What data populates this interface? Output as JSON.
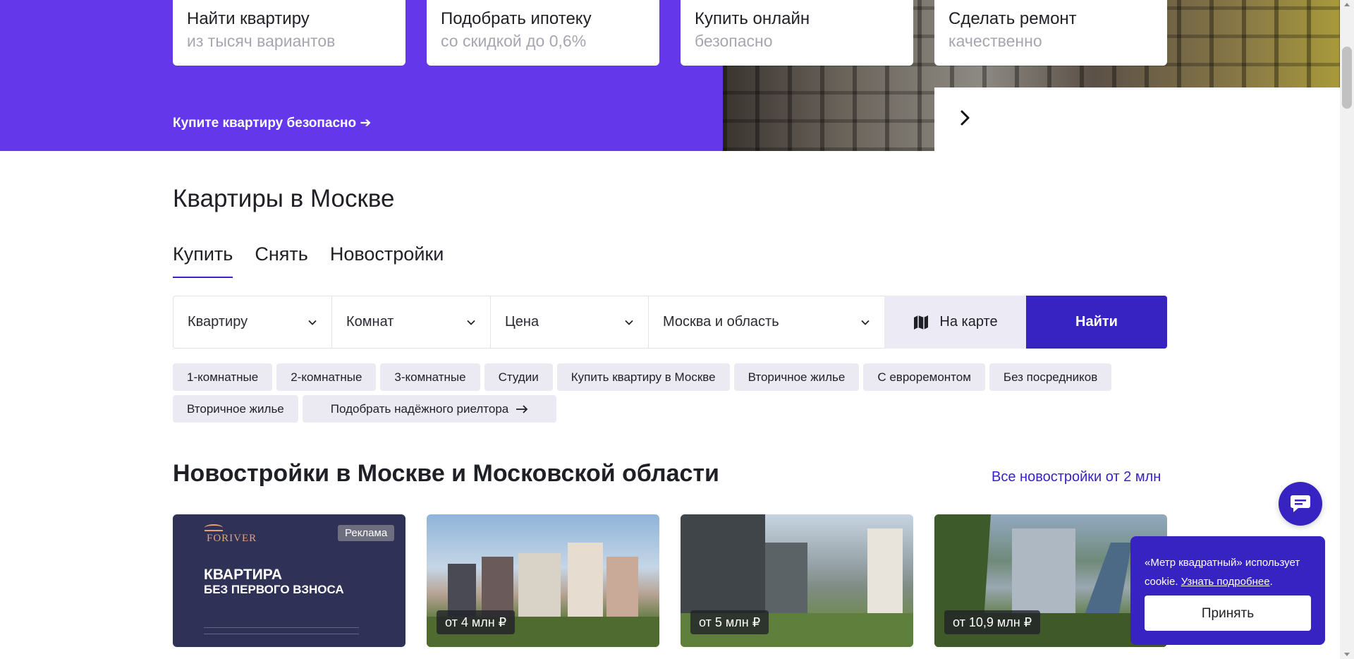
{
  "hero": {
    "cards": [
      {
        "title": "Найти квартиру",
        "subtitle": "из тысяч вариантов"
      },
      {
        "title": "Подобрать ипотеку",
        "subtitle": "со скидкой до 0,6%"
      },
      {
        "title": "Купить онлайн",
        "subtitle": "безопасно"
      },
      {
        "title": "Сделать ремонт",
        "subtitle": "качественно"
      }
    ],
    "link": "Купите квартиру безопасно ➔",
    "next_icon": "chevron-right-icon"
  },
  "flats": {
    "title": "Квартиры в Москве",
    "tabs": [
      {
        "label": "Купить",
        "active": true
      },
      {
        "label": "Снять",
        "active": false
      },
      {
        "label": "Новостройки",
        "active": false
      }
    ],
    "filters": {
      "type": "Квартиру",
      "rooms": "Комнат",
      "price": "Цена",
      "region": "Москва и область"
    },
    "map_button": "На карте",
    "find_button": "Найти",
    "chips": [
      "1-комнатные",
      "2-комнатные",
      "3-комнатные",
      "Студии",
      "Купить квартиру в Москве",
      "Вторичное жилье",
      "С евроремонтом",
      "Без посредников",
      "Вторичное жилье"
    ],
    "realtor_chip": "Подобрать надёжного риелтора"
  },
  "new_buildings": {
    "title": "Новостройки в Москве и Московской области",
    "all_link": "Все новостройки от 2 млн",
    "ad": {
      "badge": "Реклама",
      "logo": "FORIVER",
      "headline": "КВАРТИРА",
      "subline": "БЕЗ ПЕРВОГО ВЗНОСА"
    },
    "prices": [
      "от 4 млн ₽",
      "от 5 млн ₽",
      "от 10,9 млн ₽"
    ]
  },
  "cookie": {
    "text": "«Метр квадратный» использует cookie.",
    "link": "Узнать подробнее",
    "accept": "Принять"
  },
  "colors": {
    "brand": "#3722c2",
    "hero_bg": "#6437ea",
    "chip_bg": "#ebeaf2"
  }
}
